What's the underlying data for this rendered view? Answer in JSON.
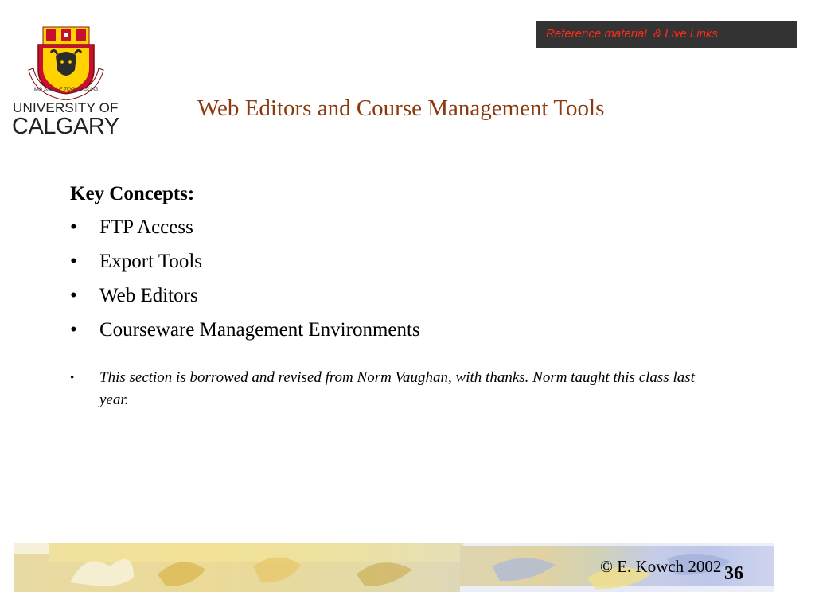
{
  "logo": {
    "motto": "MO SHÙILE TOGAM SÙAS",
    "line1": "UNIVERSITY OF",
    "line2": "CALGARY"
  },
  "reference_link": "Reference material  & Live Links",
  "slide_title": "Web Editors and Course Management Tools",
  "key_concepts": {
    "heading": "Key Concepts:",
    "items": [
      "FTP Access",
      "Export Tools",
      "Web Editors",
      "Courseware Management Environments"
    ]
  },
  "bullet_glyph": "•",
  "note": "This section is borrowed and revised from Norm Vaughan, with thanks. Norm taught this class last year.",
  "footer": {
    "copyright": "© E. Kowch 2002",
    "page_number": "36"
  },
  "colors": {
    "title": "#8b3a0e",
    "reference_box": "#333333",
    "reference_text": "#ff2a1a",
    "crest_red": "#c8102e",
    "crest_gold": "#ffd200"
  }
}
